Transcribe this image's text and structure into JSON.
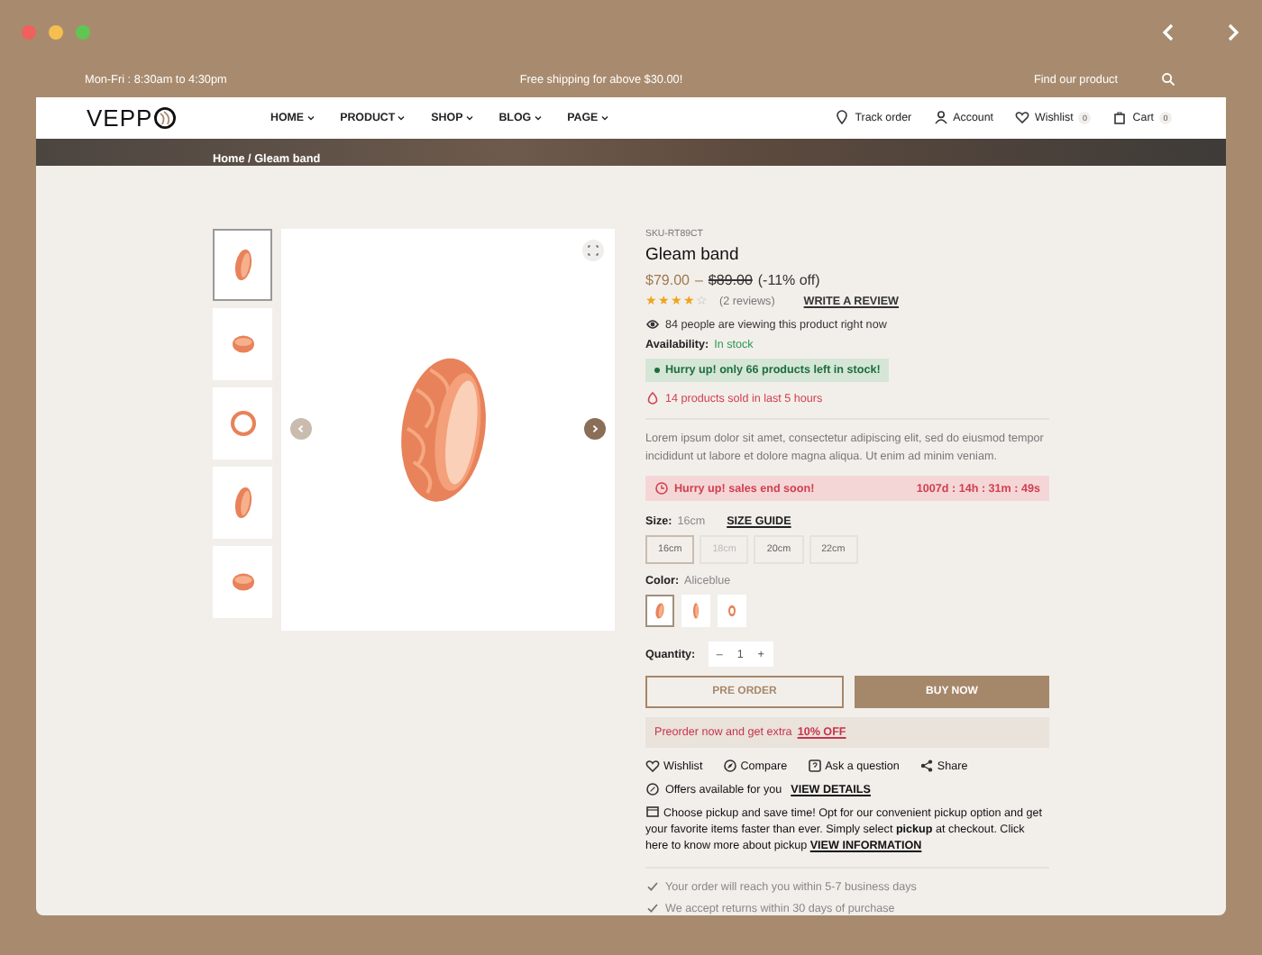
{
  "topbar": {
    "hours": "Mon-Fri : 8:30am to 4:30pm",
    "shipping": "Free shipping for above $30.00!",
    "find": "Find our product"
  },
  "nav": {
    "logo": "VEPP",
    "menu": [
      {
        "label": "HOME"
      },
      {
        "label": "PRODUCT"
      },
      {
        "label": "SHOP"
      },
      {
        "label": "BLOG"
      },
      {
        "label": "PAGE"
      }
    ],
    "links": [
      {
        "kind": "track",
        "label": "Track order"
      },
      {
        "kind": "account",
        "label": "Account"
      },
      {
        "kind": "wishlist",
        "label": "Wishlist",
        "badge": "0"
      },
      {
        "kind": "cart",
        "label": "Cart",
        "badge": "0"
      }
    ]
  },
  "breadcrumb": "Home / Gleam band",
  "gallery": {
    "thumbnails": [
      {
        "kind": "tilted",
        "selected": true
      },
      {
        "kind": "side",
        "selected": false
      },
      {
        "kind": "round",
        "selected": false
      },
      {
        "kind": "tilted",
        "selected": false
      },
      {
        "kind": "side",
        "selected": false
      }
    ]
  },
  "product": {
    "sku": "SKU-RT89CT",
    "title": "Gleam band",
    "price": "$79.00",
    "separator": "–",
    "old_price": "$89.00",
    "discount": "(-11% off)",
    "stars": 4,
    "reviews": "(2 reviews)",
    "write_review": "WRITE A REVIEW",
    "viewers": "84 people are viewing this product right now",
    "availability_label": "Availability:",
    "availability": "In stock",
    "stock_alert": "Hurry up! only 66 products left in stock!",
    "sold": "14 products sold in last 5 hours",
    "description": "Lorem ipsum dolor sit amet, consectetur adipiscing elit, sed do eiusmod tempor incididunt ut labore et dolore magna aliqua. Ut enim ad minim veniam.",
    "sale_banner": "Hurry up! sales end soon!",
    "countdown": "1007d : 14h : 31m : 49s",
    "size_label": "Size:",
    "size_value": "16cm",
    "size_guide": "SIZE GUIDE",
    "sizes": [
      {
        "label": "16cm",
        "selected": true,
        "disabled": false
      },
      {
        "label": "18cm",
        "selected": false,
        "disabled": true
      },
      {
        "label": "20cm",
        "selected": false,
        "disabled": false
      },
      {
        "label": "22cm",
        "selected": false,
        "disabled": false
      }
    ],
    "color_label": "Color:",
    "color_value": "Aliceblue",
    "swatches": [
      {
        "kind": "tilted",
        "selected": true
      },
      {
        "kind": "upright",
        "selected": false
      },
      {
        "kind": "front",
        "selected": false
      }
    ],
    "quantity_label": "Quantity:",
    "minus": "–",
    "quantity": "1",
    "plus": "+",
    "pre_order": "PRE ORDER",
    "buy_now": "BUY NOW",
    "preorder_note": "Preorder now and get extra",
    "preorder_link": "10% OFF",
    "actions": [
      {
        "kind": "wishlist",
        "label": "Wishlist"
      },
      {
        "kind": "compare",
        "label": "Compare"
      },
      {
        "kind": "ask",
        "label": "Ask a question"
      },
      {
        "kind": "share",
        "label": "Share"
      }
    ],
    "offers": "Offers available for you",
    "offers_link": "VIEW DETAILS",
    "pickup": "Choose pickup and save time! Opt for our convenient pickup option and get your favorite items faster than ever. Simply select **pickup** at checkout. Click here to know more about pickup",
    "pickup_link": "VIEW INFORMATION",
    "guarantees": [
      {
        "label": "Your order will reach you within 5-7 business days"
      },
      {
        "label": "We accept returns within 30 days of purchase"
      }
    ]
  }
}
